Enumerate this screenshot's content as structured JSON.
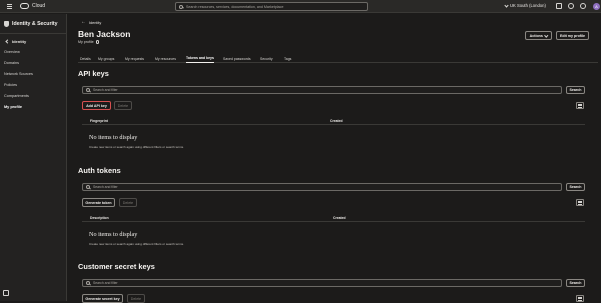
{
  "topbar": {
    "brand": "Cloud",
    "search_placeholder": "Search resources, services, documentation, and Marketplace",
    "region": "UK South (London)",
    "avatar_initial": "A"
  },
  "sidebar": {
    "title": "Identity & Security",
    "back_label": "Identity",
    "items": [
      {
        "label": "Overview"
      },
      {
        "label": "Domains"
      },
      {
        "label": "Network Sources"
      },
      {
        "label": "Policies"
      },
      {
        "label": "Compartments"
      },
      {
        "label": "My profile"
      }
    ]
  },
  "main": {
    "breadcrumb": "Identity",
    "user_name": "Ben Jackson",
    "subtitle": "My profile",
    "actions_label": "Actions",
    "edit_label": "Edit my profile",
    "tabs": [
      {
        "label": "Details"
      },
      {
        "label": "My groups"
      },
      {
        "label": "My requests"
      },
      {
        "label": "My resources"
      },
      {
        "label": "Tokens and keys"
      },
      {
        "label": "Saved passwords"
      },
      {
        "label": "Security"
      },
      {
        "label": "Tags"
      }
    ]
  },
  "api_keys": {
    "heading": "API keys",
    "filter_placeholder": "Search and filter",
    "search_label": "Search",
    "add_label": "Add API key",
    "delete_label": "Delete",
    "col_fingerprint": "Fingerprint",
    "col_created": "Created",
    "empty_title": "No items to display",
    "empty_sub": "Create new items or search again using different filters or search terms."
  },
  "auth_tokens": {
    "heading": "Auth tokens",
    "filter_placeholder": "Search and filter",
    "search_label": "Search",
    "generate_label": "Generate token",
    "delete_label": "Delete",
    "col_description": "Description",
    "col_created": "Created",
    "empty_title": "No items to display",
    "empty_sub": "Create new items or search again using different filters or search terms."
  },
  "secret_keys": {
    "heading": "Customer secret keys",
    "filter_placeholder": "Search and filter",
    "search_label": "Search",
    "generate_label": "Generate secret key",
    "delete_label": "Delete"
  }
}
